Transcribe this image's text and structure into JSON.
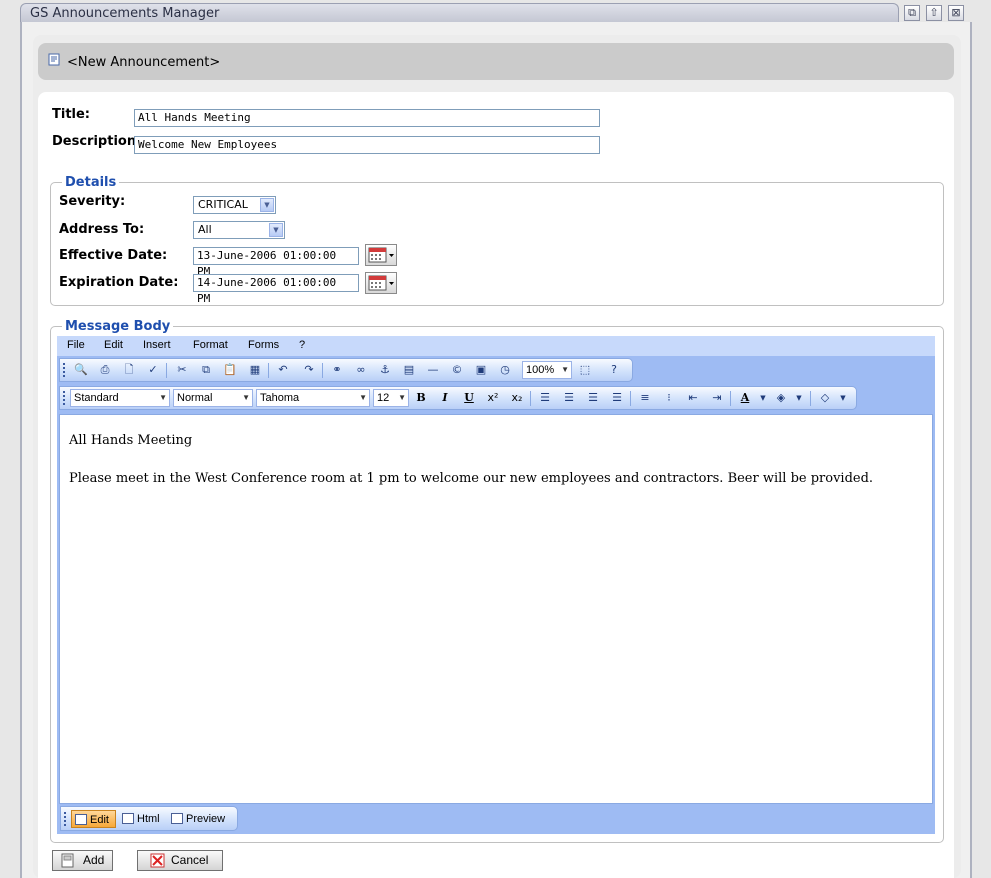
{
  "window": {
    "title": "GS Announcements Manager",
    "buttons": [
      "restore",
      "up",
      "close"
    ]
  },
  "header": {
    "title": "<New Announcement>"
  },
  "form": {
    "title_label": "Title:",
    "title_value": "All Hands Meeting",
    "description_label": "Description:",
    "description_value": "Welcome New Employees"
  },
  "details": {
    "legend": "Details",
    "severity_label": "Severity:",
    "severity_value": "CRITICAL",
    "address_label": "Address To:",
    "address_value": "All",
    "effective_label": "Effective Date:",
    "effective_value": "13-June-2006 01:00:00 PM",
    "expiration_label": "Expiration Date:",
    "expiration_value": "14-June-2006 01:00:00 PM"
  },
  "message_body": {
    "legend": "Message Body",
    "menu": [
      "File",
      "Edit",
      "Insert",
      "Format",
      "Forms",
      "?"
    ],
    "zoom": "100%",
    "style": "Standard",
    "paragraph": "Normal",
    "font": "Tahoma",
    "size": "12",
    "content_heading": "All Hands Meeting",
    "content_body": "Please meet in the West Conference room at 1 pm to welcome our new employees and contractors. Beer will be provided.",
    "modes": {
      "edit": "Edit",
      "html": "Html",
      "preview": "Preview"
    }
  },
  "actions": {
    "add": "Add",
    "cancel": "Cancel"
  }
}
